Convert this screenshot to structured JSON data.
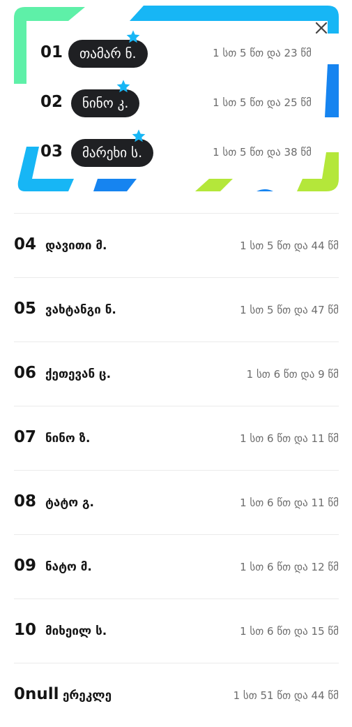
{
  "colors": {
    "green": "#5ef0a8",
    "cyan": "#17b6f5",
    "blue": "#1684f0",
    "lime": "#b4e73a",
    "pill": "#1f2023",
    "star": "#17b6f5"
  },
  "close_icon": "close-icon",
  "top3": [
    {
      "rank": "01",
      "name": "თამარ ნ.",
      "time": "1 სთ 5 წთ და 23 წმ"
    },
    {
      "rank": "02",
      "name": "ნინო კ.",
      "time": "1 სთ 5 წთ და 25 წმ"
    },
    {
      "rank": "03",
      "name": "მარეხი ს.",
      "time": "1 სთ 5 წთ და 38 წმ"
    }
  ],
  "rows": [
    {
      "rank": "04",
      "name": "დავითი მ.",
      "time": "1 სთ 5 წთ და 44 წმ"
    },
    {
      "rank": "05",
      "name": "ვახტანგი ნ.",
      "time": "1 სთ 5 წთ და 47 წმ"
    },
    {
      "rank": "06",
      "name": "ქეთევან ც.",
      "time": "1 სთ 6 წთ და 9 წმ"
    },
    {
      "rank": "07",
      "name": "ნინო ზ.",
      "time": "1 სთ 6 წთ და 11 წმ"
    },
    {
      "rank": "08",
      "name": "ტატო გ.",
      "time": "1 სთ 6 წთ და 11 წმ"
    },
    {
      "rank": "09",
      "name": "ნატო მ.",
      "time": "1 სთ 6 წთ და 12 წმ"
    },
    {
      "rank": "10",
      "name": "მიხეილ ს.",
      "time": "1 სთ 6 წთ და 15 წმ"
    },
    {
      "rank": "0null",
      "name": "ერეკლე",
      "time": "1 სთ 51 წთ და 44 წმ"
    }
  ]
}
